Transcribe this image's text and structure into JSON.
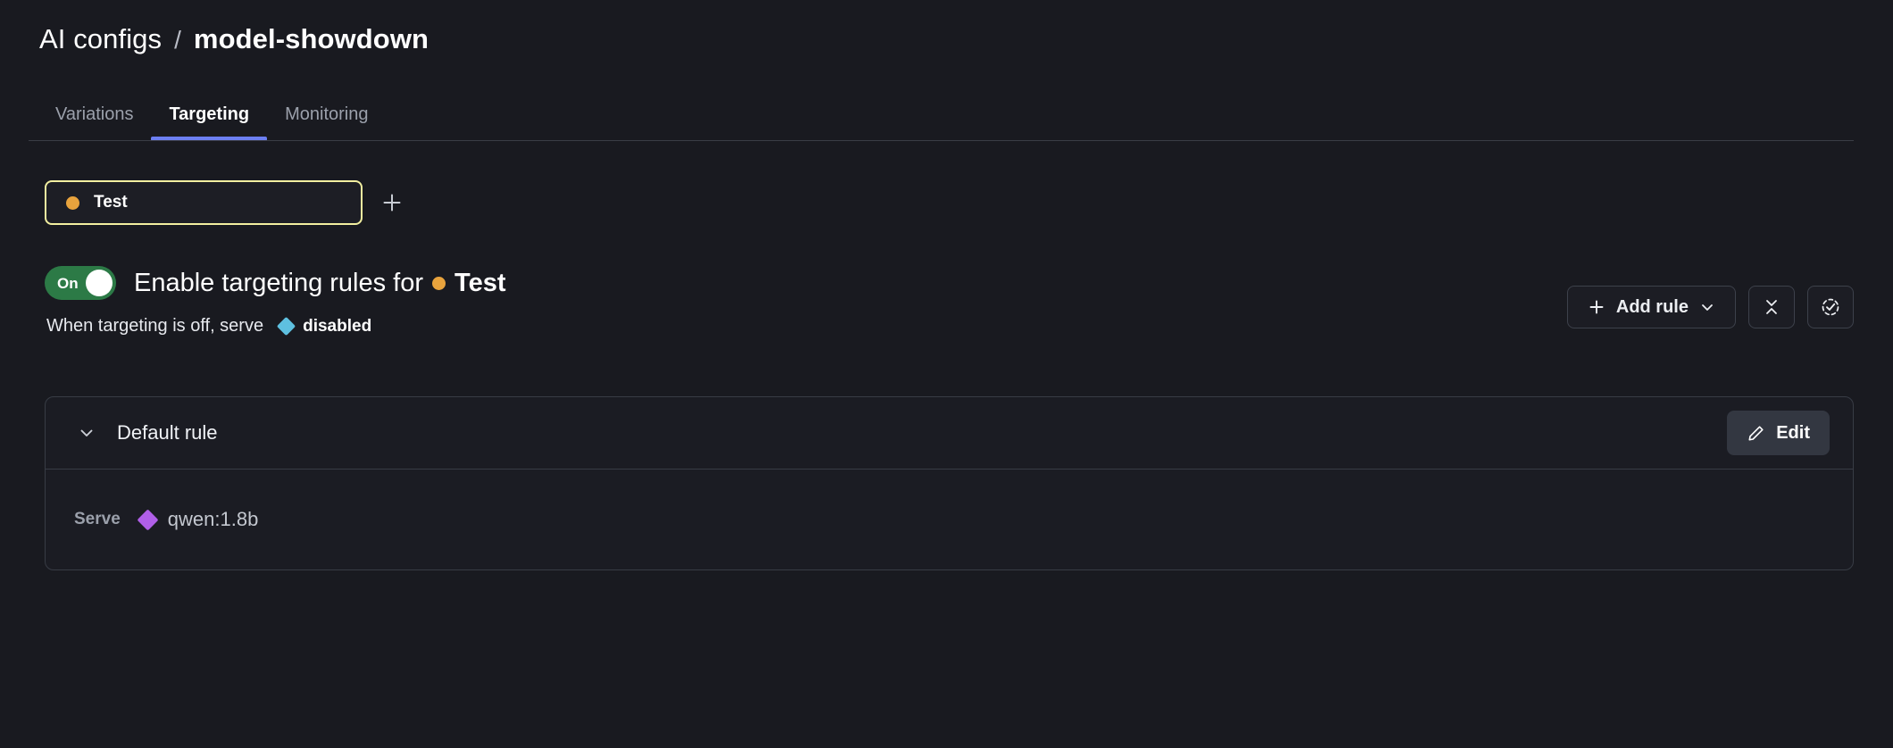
{
  "breadcrumb": {
    "parent": "AI configs",
    "separator": "/",
    "current": "model-showdown"
  },
  "tabs": [
    {
      "label": "Variations",
      "active": false
    },
    {
      "label": "Targeting",
      "active": true
    },
    {
      "label": "Monitoring",
      "active": false
    }
  ],
  "environment": {
    "name": "Test",
    "dot_color": "#e8a33d",
    "border_color": "#f2efa0",
    "add_button_icon": "plus-icon"
  },
  "targeting": {
    "toggle_state": "On",
    "toggle_color": "#2c7a46",
    "title_prefix": "Enable targeting rules for",
    "title_env": "Test",
    "fallthrough_label": "When targeting is off, serve",
    "fallthrough_variation": "disabled",
    "fallthrough_color": "#5ec0e0"
  },
  "actions": {
    "add_rule_label": "Add rule",
    "add_rule_icon": "plus-icon",
    "add_rule_caret": "chevron-down-icon",
    "collapse_all_icon": "collapse-icon",
    "review_icon": "check-circle-dashed-icon"
  },
  "default_rule": {
    "title": "Default rule",
    "expand_icon": "chevron-down-icon",
    "edit_label": "Edit",
    "edit_icon": "pencil-icon",
    "serve_label": "Serve",
    "serve_variation": "qwen:1.8b",
    "serve_color": "#b05fe8"
  }
}
